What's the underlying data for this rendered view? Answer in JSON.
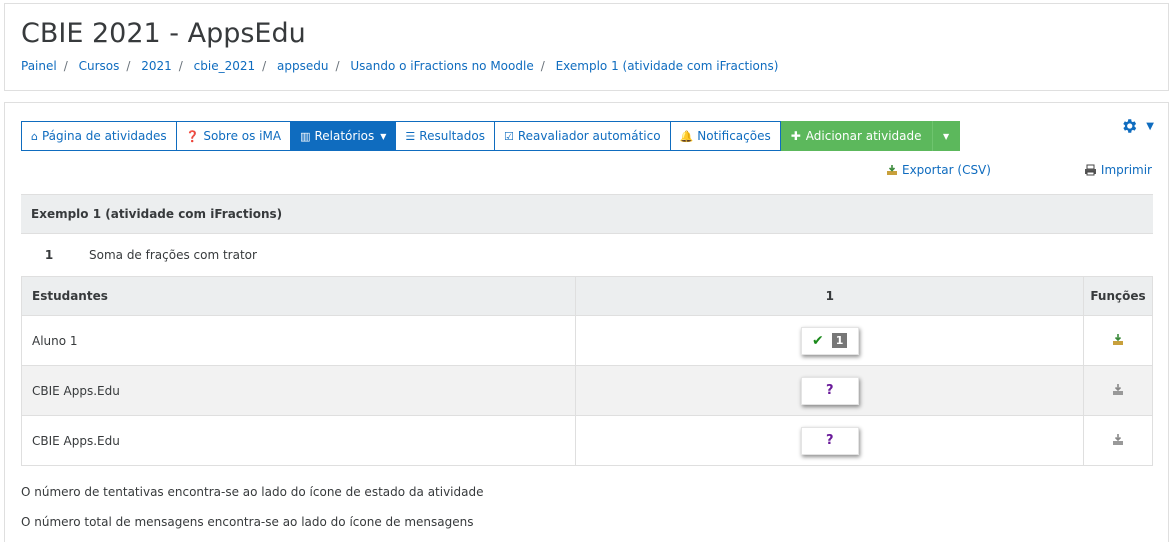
{
  "header": {
    "title": "CBIE 2021 - AppsEdu",
    "breadcrumb": [
      "Painel",
      "Cursos",
      "2021",
      "cbie_2021",
      "appsedu",
      "Usando o iFractions no Moodle",
      "Exemplo 1 (atividade com iFractions)"
    ]
  },
  "tabs": [
    {
      "label": "Página de atividades",
      "icon": "home-icon"
    },
    {
      "label": "Sobre os iMA",
      "icon": "question-circle-icon"
    },
    {
      "label": "Relatórios",
      "icon": "bar-chart-icon",
      "active": true
    },
    {
      "label": "Resultados",
      "icon": "list-icon"
    },
    {
      "label": "Reavaliador automático",
      "icon": "check-square-icon"
    },
    {
      "label": "Notificações",
      "icon": "bell-icon"
    }
  ],
  "add_activity": {
    "label": "Adicionar atividade",
    "color": "#5cb85c"
  },
  "actions": {
    "export": "Exportar (CSV)",
    "print": "Imprimir"
  },
  "activity": {
    "title": "Exemplo 1 (atividade com iFractions)",
    "number": "1",
    "name": "Soma de frações com trator"
  },
  "table": {
    "headers": {
      "students": "Estudantes",
      "col1": "1",
      "functions": "Funções"
    },
    "rows": [
      {
        "student": "Aluno 1",
        "status": "correct",
        "attempts": "1"
      },
      {
        "student": "CBIE Apps.Edu",
        "status": "unknown",
        "mark": "?"
      },
      {
        "student": "CBIE Apps.Edu",
        "status": "unknown",
        "mark": "?"
      }
    ]
  },
  "notes": [
    "O número de tentativas encontra-se ao lado do ícone de estado da atividade",
    "O número total de mensagens encontra-se ao lado do ícone de mensagens"
  ],
  "colors": {
    "link": "#0f6cbf",
    "success": "#5cb85c",
    "check": "#1b8a1b",
    "question": "#6a1b9a"
  }
}
